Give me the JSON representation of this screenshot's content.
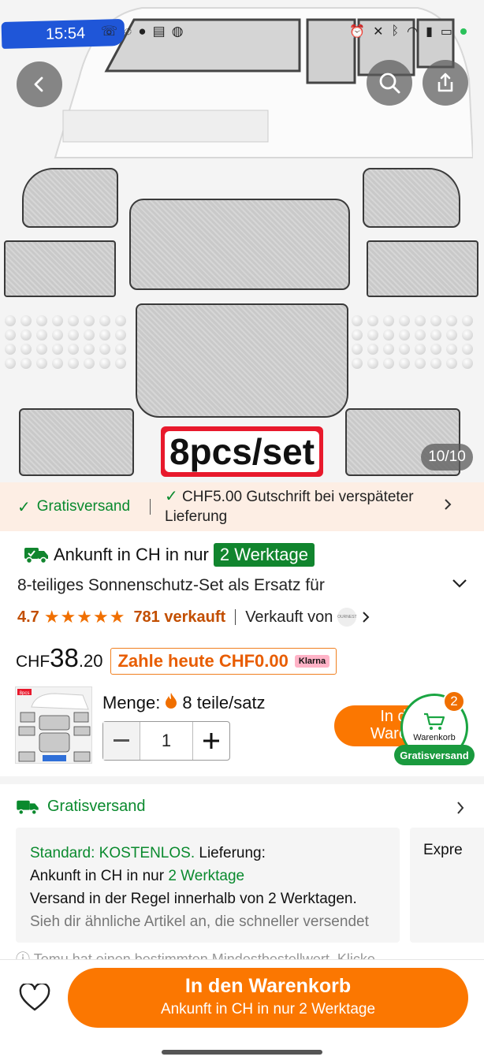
{
  "status_bar": {
    "time": "15:54",
    "indicator_color": "#2ac15a"
  },
  "hero": {
    "badge": "8pcs/set",
    "image_counter": "10/10"
  },
  "shipping_strip": {
    "free_shipping": "Gratisversand",
    "credit_text": "CHF5.00 Gutschrift bei verspäteter Lieferung"
  },
  "product": {
    "arrival_prefix": "Ankunft in CH in nur",
    "arrival_badge": "2 Werktage",
    "title": "8-teiliges Sonnenschutz-Set als Ersatz für",
    "rating": "4.7",
    "sold": "781 verkauft",
    "sold_by": "Verkauft von",
    "seller_logo_text": "OURNEST",
    "price_currency": "CHF",
    "price_main": "38",
    "price_cents": ".20",
    "pay_today": "Zahle heute CHF0.00",
    "klarna": "Klarna"
  },
  "quantity": {
    "menge_label": "Menge:",
    "menge_value": "8 teile/satz",
    "value": "1",
    "thumb_badge": "8pcs"
  },
  "mini_cart_button": {
    "label_line1": "In d",
    "label_line2": "Waren"
  },
  "cart_float": {
    "label": "Warenkorb",
    "count": "2",
    "gratis": "Gratisversand"
  },
  "shipping_section": {
    "title": "Gratisversand",
    "card": {
      "standard": "Standard: KOSTENLOS.",
      "delivery": " Lieferung:",
      "arrival_prefix": "Ankunft in CH in nur ",
      "arrival_days": "2 Werktage",
      "typical": "Versand in der Regel innerhalb von 2 Werktagen.",
      "faster": "Sieh dir ähnliche Artikel an, die schneller versendet"
    },
    "card2": "Expre",
    "notice": "Temu hat einen bestimmten Mindestbestellwert. Klicke"
  },
  "bottom_bar": {
    "cart_label": "In den Warenkorb",
    "cart_sub": "Ankunft in CH in nur 2 Werktage"
  },
  "colors": {
    "accent_orange": "#fb7701",
    "green": "#0a8a2e",
    "strip_bg": "#fdeee4"
  }
}
